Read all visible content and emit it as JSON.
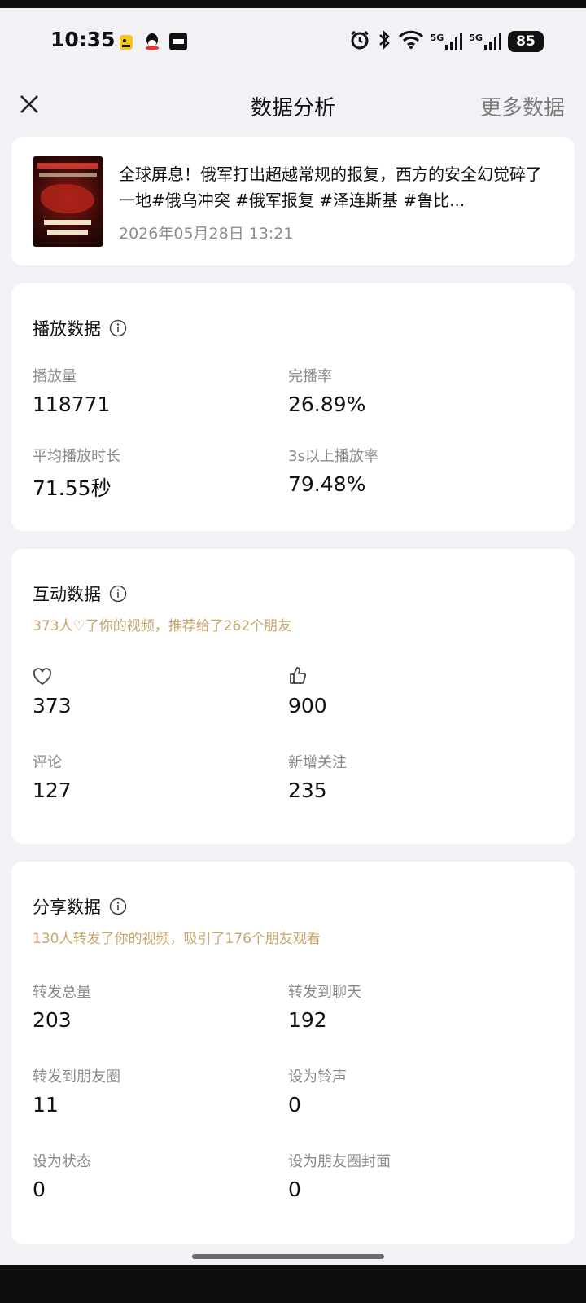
{
  "status_bar": {
    "time": "10:35",
    "notification_icons": [
      "app-badge-icon",
      "qq-icon",
      "app-icon"
    ],
    "right_icons": [
      "alarm-icon",
      "bluetooth-icon",
      "wifi-icon",
      "signal-5g-icon",
      "signal-5g-icon"
    ],
    "signal_label_1": "5G",
    "signal_label_2": "5G",
    "battery": "85"
  },
  "nav": {
    "title": "数据分析",
    "more_label": "更多数据"
  },
  "video": {
    "title": "全球屏息！俄军打出超越常规的报复，西方的安全幻觉碎了一地#俄乌冲突 #俄军报复 #泽连斯基 #鲁比...",
    "date": "2026年05月28日 13:21"
  },
  "playback": {
    "title": "播放数据",
    "metrics": [
      {
        "label": "播放量",
        "value": "118771"
      },
      {
        "label": "完播率",
        "value": "26.89%"
      },
      {
        "label": "平均播放时长",
        "value": "71.55秒"
      },
      {
        "label": "3s以上播放率",
        "value": "79.48%"
      }
    ]
  },
  "interaction": {
    "title": "互动数据",
    "subtitle": "373人♡了你的视频，推荐给了262个朋友",
    "metrics": [
      {
        "icon": "heart-icon",
        "value": "373"
      },
      {
        "icon": "thumbs-up-icon",
        "value": "900"
      },
      {
        "label": "评论",
        "value": "127"
      },
      {
        "label": "新增关注",
        "value": "235"
      }
    ]
  },
  "share": {
    "title": "分享数据",
    "subtitle": "130人转发了你的视频，吸引了176个朋友观看",
    "metrics": [
      {
        "label": "转发总量",
        "value": "203"
      },
      {
        "label": "转发到聊天",
        "value": "192"
      },
      {
        "label": "转发到朋友圈",
        "value": "11"
      },
      {
        "label": "设为铃声",
        "value": "0"
      },
      {
        "label": "设为状态",
        "value": "0"
      },
      {
        "label": "设为朋友圈封面",
        "value": "0"
      }
    ]
  },
  "colors": {
    "background": "#f1f1f6",
    "card": "#ffffff",
    "subtitle_gold": "#c8a66a",
    "label_gray": "#8a8a8a"
  }
}
